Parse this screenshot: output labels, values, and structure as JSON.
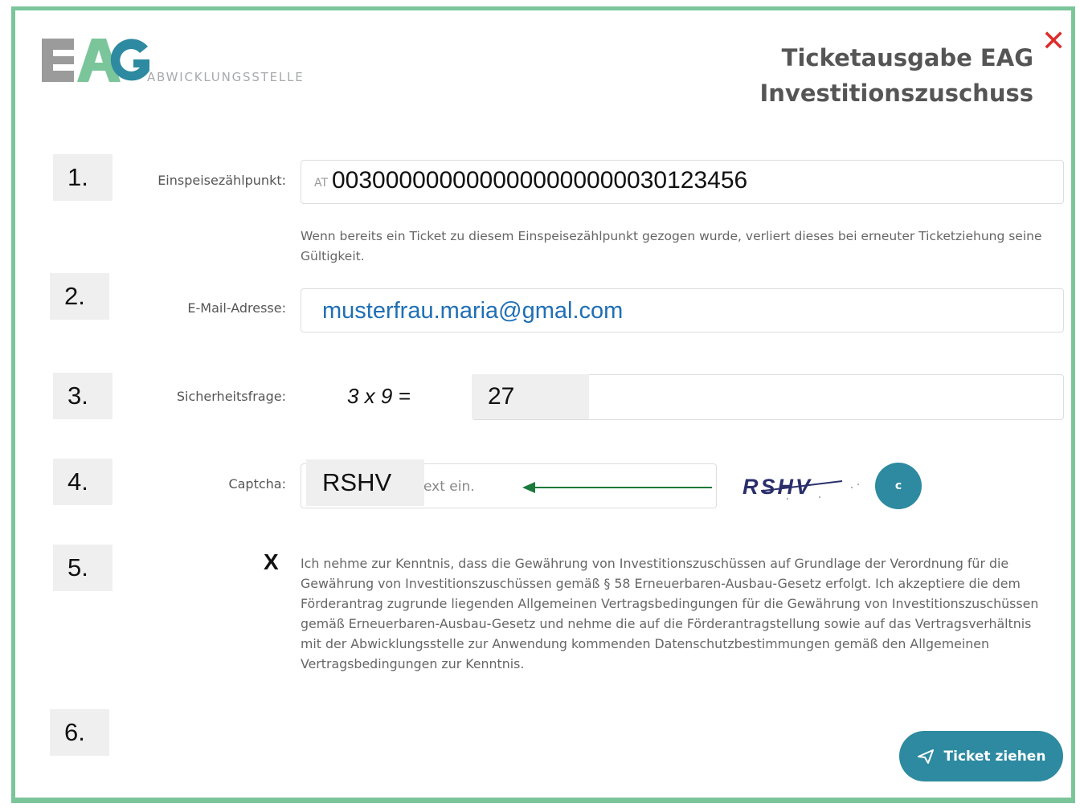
{
  "header": {
    "logo_text": "EAG",
    "logo_subtitle": "ABWICKLUNGSSTELLE",
    "title_line1": "Ticketausgabe EAG",
    "title_line2": "Investitionszuschuss",
    "close_symbol": "✕"
  },
  "steps": [
    "1.",
    "2.",
    "3.",
    "4.",
    "5.",
    "6."
  ],
  "form": {
    "meter_point": {
      "label": "Einspeisezählpunkt:",
      "prefix": "AT",
      "value": "0030000000000000000000030123456",
      "hint": "Wenn bereits ein Ticket zu diesem Einspeisezählpunkt gezogen wurde, verliert dieses bei erneuter Ticketziehung seine Gültigkeit."
    },
    "email": {
      "label": "E-Mail-Adresse:",
      "value": "musterfrau.maria@gmal.com"
    },
    "security": {
      "label": "Sicherheitsfrage:",
      "question": "3 x 9 =",
      "answer": "27"
    },
    "captcha": {
      "label": "Captcha:",
      "value": "RSHV",
      "placeholder_visible": "ext ein.",
      "image_text": "RSHV",
      "refresh_symbol": "c"
    },
    "consent": {
      "mark": "X",
      "text": "Ich nehme zur Kenntnis, dass die Gewährung von Investitionszuschüssen auf Grundlage der Verordnung für die Gewährung von Investitionszuschüssen gemäß § 58 Erneuerbaren-Ausbau-Gesetz erfolgt. Ich akzeptiere die dem Förderantrag zugrunde liegenden Allgemeinen Vertragsbedingungen für die Gewährung von Investitionszuschüssen gemäß Erneuerbaren-Ausbau-Gesetz und nehme die auf die Förderantragstellung sowie auf das Vertragsverhältnis mit der Abwicklungsstelle zur Anwendung kommenden Datenschutzbestimmungen gemäß den Allgemeinen Vertragsbedingungen zur Kenntnis."
    },
    "submit_label": "Ticket ziehen"
  },
  "icons": {
    "close": "close-icon",
    "refresh": "refresh-icon",
    "submit": "send-icon",
    "arrow": "arrow-left-icon"
  },
  "colors": {
    "frame": "#7bc59a",
    "accent": "#2d8aa0",
    "email_text": "#1f6fb5",
    "close": "#e02b2b",
    "arrow": "#1a7a3a"
  }
}
